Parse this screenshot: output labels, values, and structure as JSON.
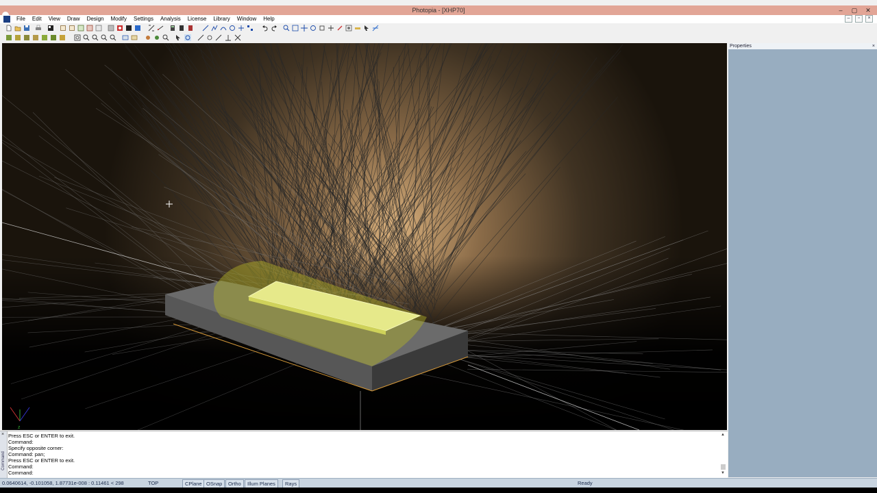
{
  "window": {
    "title": "Photopia - [XHP70]",
    "controls": {
      "minimize": "–",
      "maximize": "▢",
      "close": "✕"
    }
  },
  "menu": {
    "items": [
      "File",
      "Edit",
      "View",
      "Draw",
      "Design",
      "Modify",
      "Settings",
      "Analysis",
      "License",
      "Library",
      "Window",
      "Help"
    ]
  },
  "properties_panel": {
    "title": "Properties",
    "close": "×"
  },
  "command": {
    "side_label": "Command",
    "close": "×",
    "lines": [
      "Press ESC or ENTER to exit.",
      "Command:",
      "Specify opposite corner:",
      "Command: pan;",
      "Press ESC or ENTER to exit.",
      "Command:",
      "Command:"
    ]
  },
  "status": {
    "coords": "0.0640614, -0.101058, 1.87731e-008 : 0.11461 < 298",
    "view": "TOP",
    "toggles": [
      "CPlane",
      "OSnap",
      "Ortho",
      "Illum Planes",
      "Rays"
    ],
    "state": "Ready"
  },
  "colors": {
    "title_bar": "#e2a596",
    "panel_bg": "#98adc0",
    "led_yellow": "#e6e98a",
    "package_gray": "#6b6b6b"
  }
}
